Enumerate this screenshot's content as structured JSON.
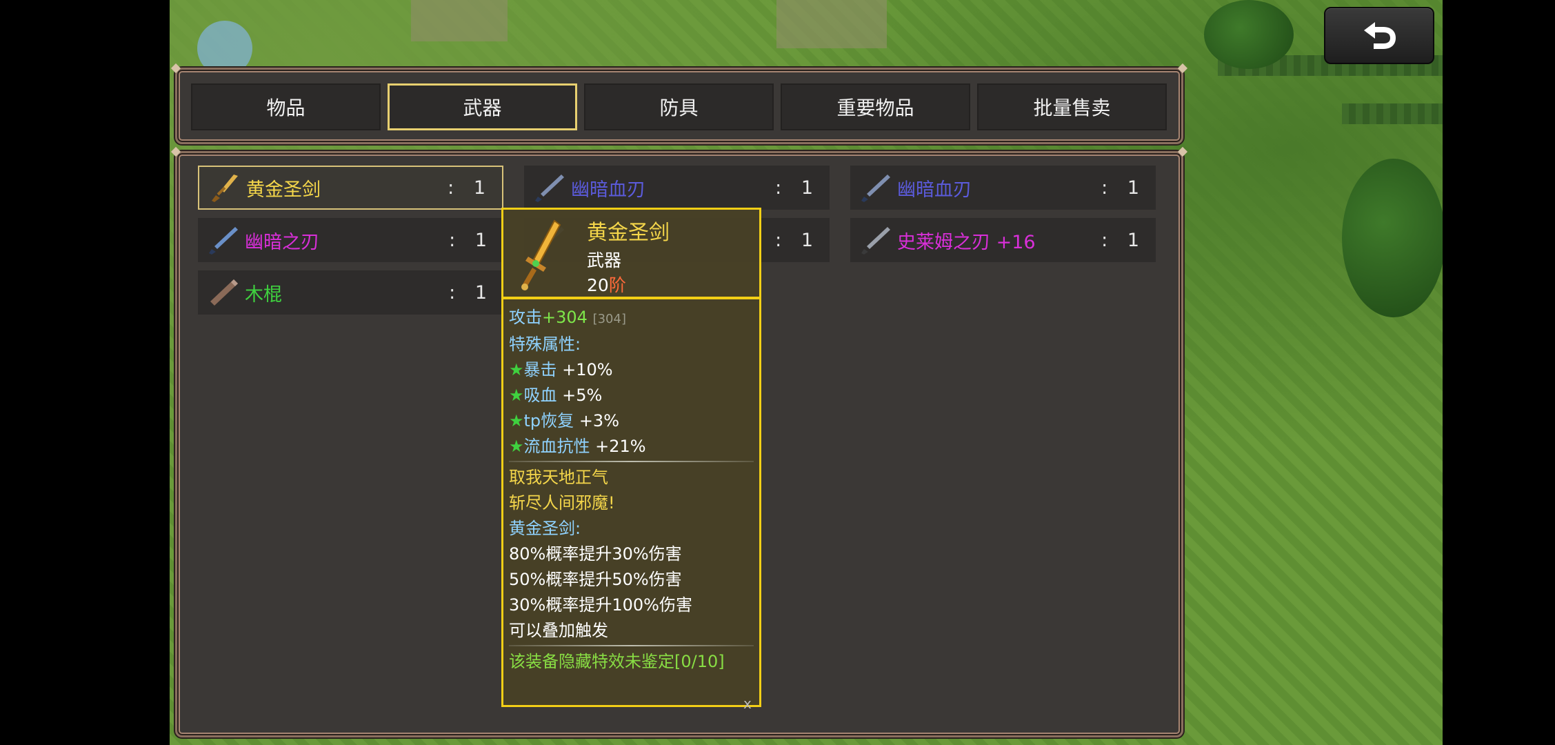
{
  "tabs": [
    {
      "label": "物品",
      "active": false
    },
    {
      "label": "武器",
      "active": true
    },
    {
      "label": "防具",
      "active": false
    },
    {
      "label": "重要物品",
      "active": false
    },
    {
      "label": "批量售卖",
      "active": false
    }
  ],
  "items": [
    {
      "name": "黄金圣剑",
      "qty": ": 1",
      "color": "#f4d64a",
      "icon": "golden-sword-icon"
    },
    {
      "name": "幽暗血刃",
      "qty": ": 1",
      "color": "#5b5bdc",
      "icon": "dark-blade-icon"
    },
    {
      "name": "幽暗血刃",
      "qty": ": 1",
      "color": "#5b5bdc",
      "icon": "dark-blade-icon"
    },
    {
      "name": "幽暗之刃",
      "qty": ": 1",
      "color": "#d92fd9",
      "icon": "dark-blade-icon"
    },
    {
      "name": "",
      "qty": ": 1",
      "color": "#5b5bdc",
      "icon": "dark-blade-icon"
    },
    {
      "name": "史莱姆之刃 +16",
      "qty": ": 1",
      "color": "#d92fd9",
      "icon": "dark-blade-icon"
    },
    {
      "name": "木棍",
      "qty": ": 1",
      "color": "#3fd13f",
      "icon": "wooden-stick-icon"
    }
  ],
  "tooltip": {
    "name": "黄金圣剑",
    "type": "武器",
    "tier_num": "20",
    "tier_suffix": "阶",
    "attack_label": "攻击",
    "attack_value": "+304",
    "attack_base": "[304]",
    "special_label": "特殊属性:",
    "bonuses": [
      {
        "name": "暴击",
        "value": "+10%"
      },
      {
        "name": "吸血",
        "value": "+5%"
      },
      {
        "name": "tp恢复",
        "value": "+3%"
      },
      {
        "name": "流血抗性",
        "value": "+21%"
      }
    ],
    "lore": [
      "取我天地正气",
      "斩尽人间邪魔!"
    ],
    "effect_title": "黄金圣剑:",
    "effects": [
      "80%概率提升30%伤害",
      "50%概率提升50%伤害",
      "30%概率提升100%伤害",
      "可以叠加触发"
    ],
    "hidden": "该装备隐藏特效未鉴定[0/10]",
    "close": "x"
  }
}
